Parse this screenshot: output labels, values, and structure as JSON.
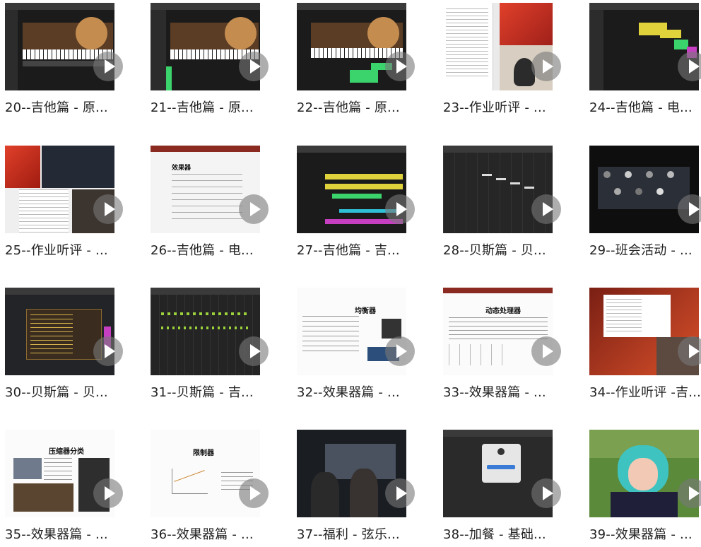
{
  "videos": [
    {
      "title": "20--吉他篇 - 原..."
    },
    {
      "title": "21--吉他篇 - 原..."
    },
    {
      "title": "22--吉他篇 - 原..."
    },
    {
      "title": "23--作业听评 - ..."
    },
    {
      "title": "24--吉他篇 - 电..."
    },
    {
      "title": "25--作业听评 - ..."
    },
    {
      "title": "26--吉他篇 - 电..."
    },
    {
      "title": "27--吉他篇 - 吉..."
    },
    {
      "title": "28--贝斯篇 - 贝..."
    },
    {
      "title": "29--班会活动 - ..."
    },
    {
      "title": "30--贝斯篇 - 贝..."
    },
    {
      "title": "31--贝斯篇 - 吉..."
    },
    {
      "title": "32--效果器篇 - ..."
    },
    {
      "title": "33--效果器篇 - ..."
    },
    {
      "title": "34--作业听评 -吉..."
    },
    {
      "title": "35--效果器篇 - ..."
    },
    {
      "title": "36--效果器篇 - ..."
    },
    {
      "title": "37--福利 - 弦乐..."
    },
    {
      "title": "38--加餐 - 基础..."
    },
    {
      "title": "39--效果器篇 - ..."
    }
  ],
  "slides": {
    "s26": "效果器",
    "s32": "均衡器",
    "s33": "动态处理器",
    "s35": "压缩器分类",
    "s36": "限制器"
  },
  "icons": {
    "play": "play-icon"
  },
  "colors": {
    "daw_dark": "#1b1b1b",
    "accent_yellow": "#e0d23a",
    "accent_green": "#3bd36b",
    "accent_magenta": "#c53fc0",
    "accent_cyan": "#2fc0d8"
  }
}
